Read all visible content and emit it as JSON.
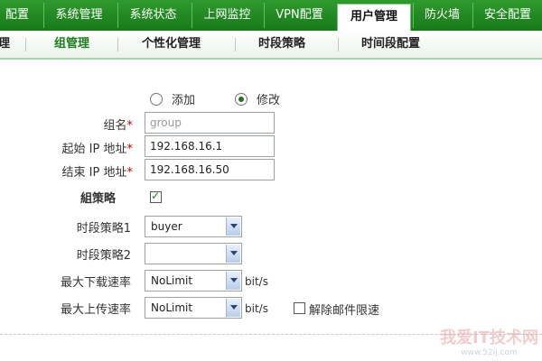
{
  "top_nav": {
    "tabs": [
      {
        "label": "配置"
      },
      {
        "label": "系统管理"
      },
      {
        "label": "系统状态"
      },
      {
        "label": "上网监控"
      },
      {
        "label": "VPN配置"
      },
      {
        "label": "用户管理"
      },
      {
        "label": "防火墙"
      },
      {
        "label": "安全配置"
      }
    ],
    "active": "用户管理"
  },
  "sub_nav": {
    "items": [
      {
        "label": "理"
      },
      {
        "label": "组管理"
      },
      {
        "label": "个性化管理"
      },
      {
        "label": "时段策略"
      },
      {
        "label": "时间段配置"
      }
    ],
    "active": "组管理"
  },
  "form": {
    "mode_add_label": "添加",
    "mode_edit_label": "修改",
    "mode_selected": "修改",
    "group_name_label": "组名",
    "group_name_placeholder": "group",
    "start_ip_label": "起始 IP 地址",
    "start_ip_value": "192.168.16.1",
    "end_ip_label": "结束 IP 地址",
    "end_ip_value": "192.168.16.50",
    "required_mark": "*",
    "group_policy_label": "組策略",
    "group_policy_checked": true,
    "time_policy1_label": "时段策略1",
    "time_policy1_value": "buyer",
    "time_policy2_label": "时段策略2",
    "time_policy2_value": "",
    "max_download_label": "最大下载速率",
    "max_download_value": "NoLimit",
    "max_upload_label": "最大上传速率",
    "max_upload_value": "NoLimit",
    "unit_label": "bit/s",
    "exempt_mail_label": "解除邮件限速",
    "exempt_mail_checked": false
  },
  "watermark": {
    "text": "我爱IT技术网",
    "url": "www.52ij.com"
  },
  "colors": {
    "nav_green": "#1f8a1f",
    "active_sub": "#1d7d1d",
    "required": "#c00000"
  }
}
